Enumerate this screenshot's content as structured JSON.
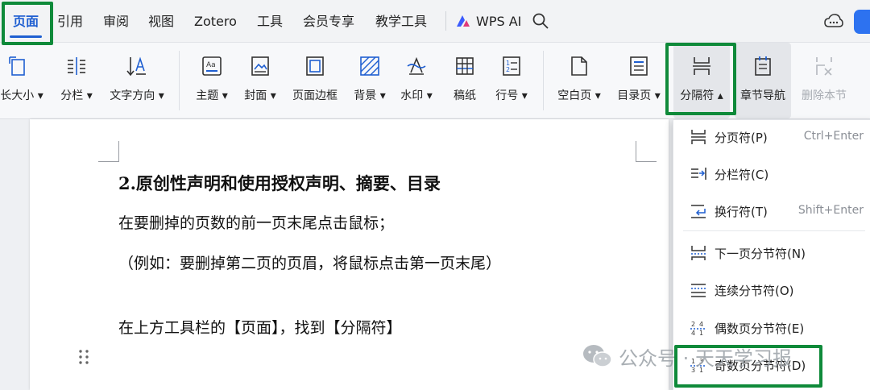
{
  "menubar": {
    "items": [
      "页面",
      "引用",
      "审阅",
      "视图",
      "Zotero",
      "工具",
      "会员专享",
      "教学工具"
    ],
    "ai_label": "WPS AI"
  },
  "ribbon": {
    "items": [
      {
        "label": "长大小",
        "icon": "page-size-icon",
        "dropdown": true
      },
      {
        "label": "分栏",
        "icon": "columns-icon",
        "dropdown": true
      },
      {
        "label": "文字方向",
        "icon": "text-direction-icon",
        "dropdown": true
      },
      {
        "label": "主题",
        "icon": "theme-icon",
        "dropdown": true
      },
      {
        "label": "封面",
        "icon": "cover-icon",
        "dropdown": true
      },
      {
        "label": "页面边框",
        "icon": "page-border-icon",
        "dropdown": false
      },
      {
        "label": "背景",
        "icon": "background-icon",
        "dropdown": true
      },
      {
        "label": "水印",
        "icon": "watermark-icon",
        "dropdown": true
      },
      {
        "label": "稿纸",
        "icon": "manuscript-icon",
        "dropdown": false
      },
      {
        "label": "行号",
        "icon": "line-number-icon",
        "dropdown": true
      },
      {
        "label": "空白页",
        "icon": "blank-page-icon",
        "dropdown": true
      },
      {
        "label": "目录页",
        "icon": "toc-page-icon",
        "dropdown": true
      },
      {
        "label": "分隔符",
        "icon": "break-icon",
        "dropdown": true,
        "expanded": true
      },
      {
        "label": "章节导航",
        "icon": "section-nav-icon",
        "dropdown": false
      },
      {
        "label": "删除本节",
        "icon": "delete-section-icon",
        "dropdown": false,
        "disabled": true
      }
    ]
  },
  "document": {
    "heading": "2.原创性声明和使用授权声明、摘要、目录",
    "lines": [
      "在要删掉的页数的前一页末尾点击鼠标；",
      "（例如：要删掉第二页的页眉，将鼠标点击第一页末尾）",
      "在上方工具栏的【页面】，找到【分隔符】"
    ]
  },
  "dropdown": {
    "items": [
      {
        "label": "分页符(P)",
        "shortcut": "Ctrl+Enter",
        "icon": "page-break-icon"
      },
      {
        "label": "分栏符(C)",
        "shortcut": "",
        "icon": "column-break-icon"
      },
      {
        "label": "换行符(T)",
        "shortcut": "Shift+Enter",
        "icon": "line-break-icon"
      },
      {
        "label": "下一页分节符(N)",
        "shortcut": "",
        "icon": "next-page-section-break-icon"
      },
      {
        "label": "连续分节符(O)",
        "shortcut": "",
        "icon": "continuous-section-break-icon"
      },
      {
        "label": "偶数页分节符(E)",
        "shortcut": "",
        "icon": "even-page-section-break-icon"
      },
      {
        "label": "奇数页分节符(D)",
        "shortcut": "",
        "icon": "odd-page-section-break-icon"
      }
    ]
  },
  "watermark": {
    "text": "公众号 · 天天学习报"
  },
  "colors": {
    "accent": "#1f5fd1",
    "highlight_frame": "#0f8a3a",
    "disabled_text": "#a7abb2"
  }
}
